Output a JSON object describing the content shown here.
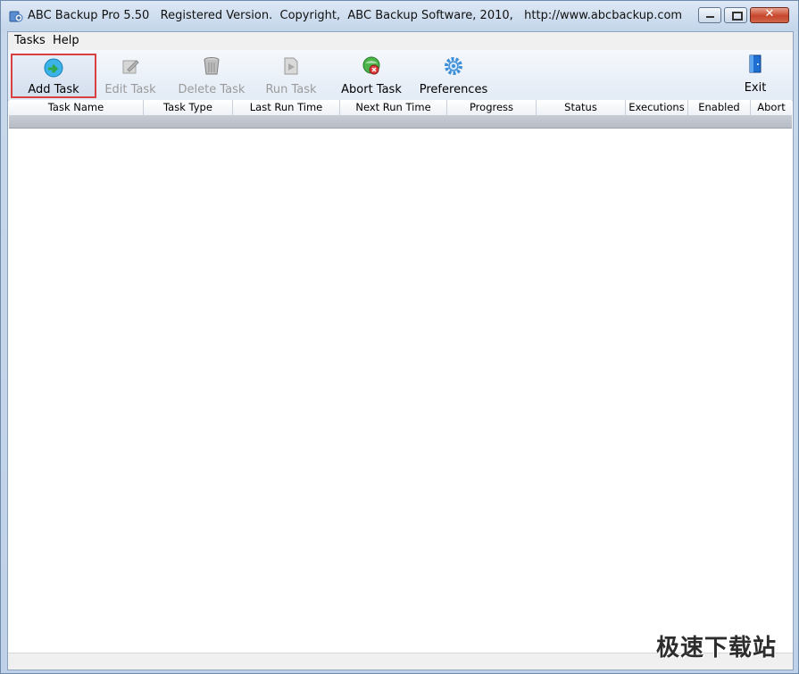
{
  "window": {
    "title": "ABC Backup Pro 5.50   Registered Version.  Copyright,  ABC Backup Software, 2010,   http://www.abcbackup.com",
    "close_glyph": "✕"
  },
  "menu": {
    "items": [
      "Tasks",
      "Help"
    ]
  },
  "toolbar": {
    "add_task": "Add Task",
    "edit_task": "Edit Task",
    "delete_task": "Delete Task",
    "run_task": "Run Task",
    "abort_task": "Abort Task",
    "preferences": "Preferences",
    "exit": "Exit"
  },
  "grid": {
    "columns": [
      "Task Name",
      "Task Type",
      "Last Run Time",
      "Next Run Time",
      "Progress",
      "Status",
      "Executions",
      "Enabled",
      "Abort"
    ]
  },
  "watermark": "极速下载站",
  "colors": {
    "selection_border": "#d94040",
    "disabled_text": "#9a9a9a"
  }
}
